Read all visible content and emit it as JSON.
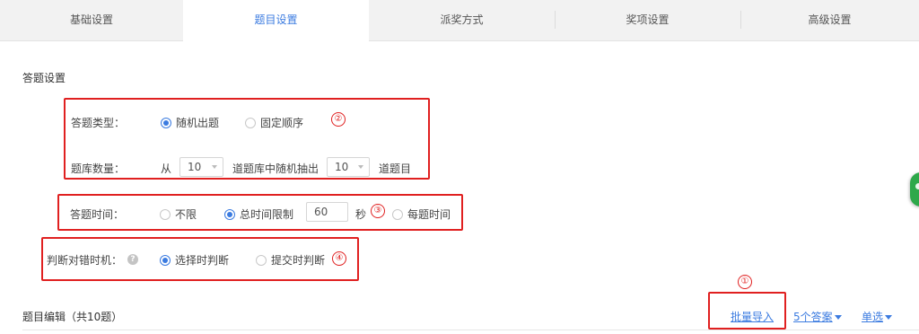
{
  "tabs": [
    {
      "label": "基础设置"
    },
    {
      "label": "题目设置"
    },
    {
      "label": "派奖方式"
    },
    {
      "label": "奖项设置"
    },
    {
      "label": "高级设置"
    }
  ],
  "active_tab_index": 1,
  "section_title": "答题设置",
  "question_type": {
    "label": "答题类型：",
    "options": [
      "随机出题",
      "固定顺序"
    ],
    "selected": "随机出题"
  },
  "question_count": {
    "label": "题库数量：",
    "from_text": "从",
    "pool_value": "10",
    "middle_text": "道题库中随机抽出",
    "draw_value": "10",
    "suffix_text": "道题目"
  },
  "answer_time": {
    "label": "答题时间：",
    "options": [
      "不限",
      "总时间限制",
      "每题时间"
    ],
    "selected": "总时间限制",
    "seconds_value": "60",
    "seconds_unit": "秒"
  },
  "judge_timing": {
    "label": "判断对错时机：",
    "options": [
      "选择时判断",
      "提交时判断"
    ],
    "selected": "选择时判断"
  },
  "annotations": [
    "①",
    "②",
    "③",
    "④"
  ],
  "question_list": {
    "title": "题目编辑（共10题）",
    "batch_import": "批量导入",
    "answers_dropdown": "5个答案",
    "type_dropdown": "单选"
  },
  "colors": {
    "accent": "#3b7be0",
    "annotation": "#e02020",
    "tab_bg": "#f2f2f2"
  }
}
